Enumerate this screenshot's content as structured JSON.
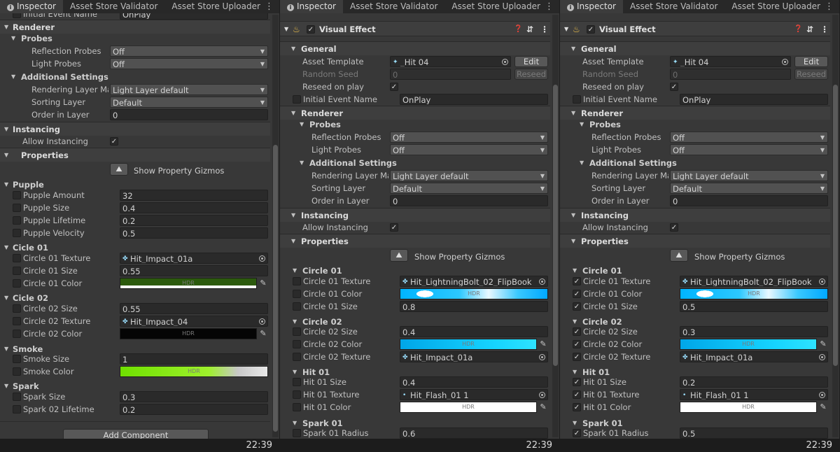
{
  "tabs": {
    "inspector": "Inspector",
    "validator": "Asset Store Validator",
    "uploader": "Asset Store Uploader"
  },
  "clock": "22:39",
  "icons": {
    "info": "info-icon",
    "menu": "kebab-menu-icon",
    "help": "help-icon",
    "settings": "preset-icon",
    "visual_effect": "visual-effect-icon",
    "check": "✓",
    "dropdown": "▼"
  },
  "component": {
    "title": "Visual Effect",
    "add_component": "Add Component"
  },
  "general": {
    "header": "General",
    "asset_template_label": "Asset Template",
    "asset_template_value": "_Hit 04",
    "edit": "Edit",
    "random_seed_label": "Random Seed",
    "random_seed_value": "0",
    "reseed": "Reseed",
    "reseed_on_play_label": "Reseed on play",
    "initial_event_label": "Initial Event Name",
    "initial_event_value": "OnPlay"
  },
  "renderer": {
    "header": "Renderer",
    "probes": "Probes",
    "reflection_probes_label": "Reflection Probes",
    "reflection_probes_value": "Off",
    "light_probes_label": "Light Probes",
    "light_probes_value": "Off",
    "additional_settings": "Additional Settings",
    "rendering_layer_mask_label": "Rendering Layer Ma:",
    "rendering_layer_mask_value": "Light Layer default",
    "sorting_layer_label": "Sorting Layer",
    "sorting_layer_value": "Default",
    "order_in_layer_label": "Order in Layer",
    "order_in_layer_value": "0"
  },
  "instancing": {
    "header": "Instancing",
    "allow_label": "Allow Instancing"
  },
  "properties": {
    "header": "Properties",
    "gizmos": "Show Property Gizmos"
  },
  "hdr": "HDR",
  "p1": {
    "cut_label": "Initial Event Name",
    "cut_value": "OnPlay",
    "puppple": {
      "header": "Pupple",
      "amount_label": "Pupple Amount",
      "amount": "32",
      "size_label": "Pupple Size",
      "size": "0.4",
      "lifetime_label": "Pupple Lifetime",
      "lifetime": "0.2",
      "velocity_label": "Pupple Velocity",
      "velocity": "0.5"
    },
    "circle01": {
      "header": "Cicle 01",
      "texture_label": "Circle 01 Texture",
      "texture": "Hit_Impact_01a",
      "size_label": "Circle 01 Size",
      "size": "0.55",
      "color_label": "Circle 01 Color"
    },
    "circle02": {
      "header": "Cicle 02",
      "size_label": "Circle 02 Size",
      "size": "0.55",
      "texture_label": "Circle 02 Texture",
      "texture": "Hit_Impact_04",
      "color_label": "Circle 02 Color"
    },
    "smoke": {
      "header": "Smoke",
      "size_label": "Smoke Size",
      "size": "1",
      "color_label": "Smoke Color"
    },
    "spark": {
      "header": "Spark",
      "size_label": "Spark Size",
      "size": "0.3",
      "lifetime_label": "Spark 02 Lifetime",
      "lifetime": "0.2"
    }
  },
  "p2": {
    "circle01": {
      "header": "Circle 01",
      "texture_label": "Circle 01 Texture",
      "texture": "Hit_LightningBolt_02_FlipBook",
      "color_label": "Circle 01 Color",
      "size_label": "Circle 01 Size",
      "size": "0.8"
    },
    "circle02": {
      "header": "Circle 02",
      "size_label": "Circle 02 Size",
      "size": "0.4",
      "color_label": "Circle 02 Color",
      "texture_label": "Circle 02 Texture",
      "texture": "Hit_Impact_01a"
    },
    "hit01": {
      "header": "Hit 01",
      "size_label": "Hit 01 Size",
      "size": "0.4",
      "texture_label": "Hit 01 Texture",
      "texture": "Hit_Flash_01 1",
      "color_label": "Hit 01 Color"
    },
    "spark01": {
      "header": "Spark 01",
      "radius_label": "Spark 01 Radius",
      "radius": "0.6"
    }
  },
  "p3": {
    "circle01": {
      "header": "Circle 01",
      "texture_label": "Circle 01 Texture",
      "texture": "Hit_LightningBolt_02_FlipBook",
      "color_label": "Circle 01 Color",
      "size_label": "Circle 01 Size",
      "size": "0.5"
    },
    "circle02": {
      "header": "Circle 02",
      "size_label": "Circle 02 Size",
      "size": "0.3",
      "color_label": "Circle 02 Color",
      "texture_label": "Circle 02 Texture",
      "texture": "Hit_Impact_01a"
    },
    "hit01": {
      "header": "Hit 01",
      "size_label": "Hit 01 Size",
      "size": "0.2",
      "texture_label": "Hit 01 Texture",
      "texture": "Hit_Flash_01 1",
      "color_label": "Hit 01 Color"
    },
    "spark01": {
      "header": "Spark 01",
      "radius_label": "Spark 01 Radius",
      "radius": "0.5"
    }
  },
  "colors": {
    "panel": "#383838",
    "header": "#3e3e3e",
    "field": "#2a2a2a",
    "tabbar": "#282828",
    "status": "#1c1c1c"
  }
}
